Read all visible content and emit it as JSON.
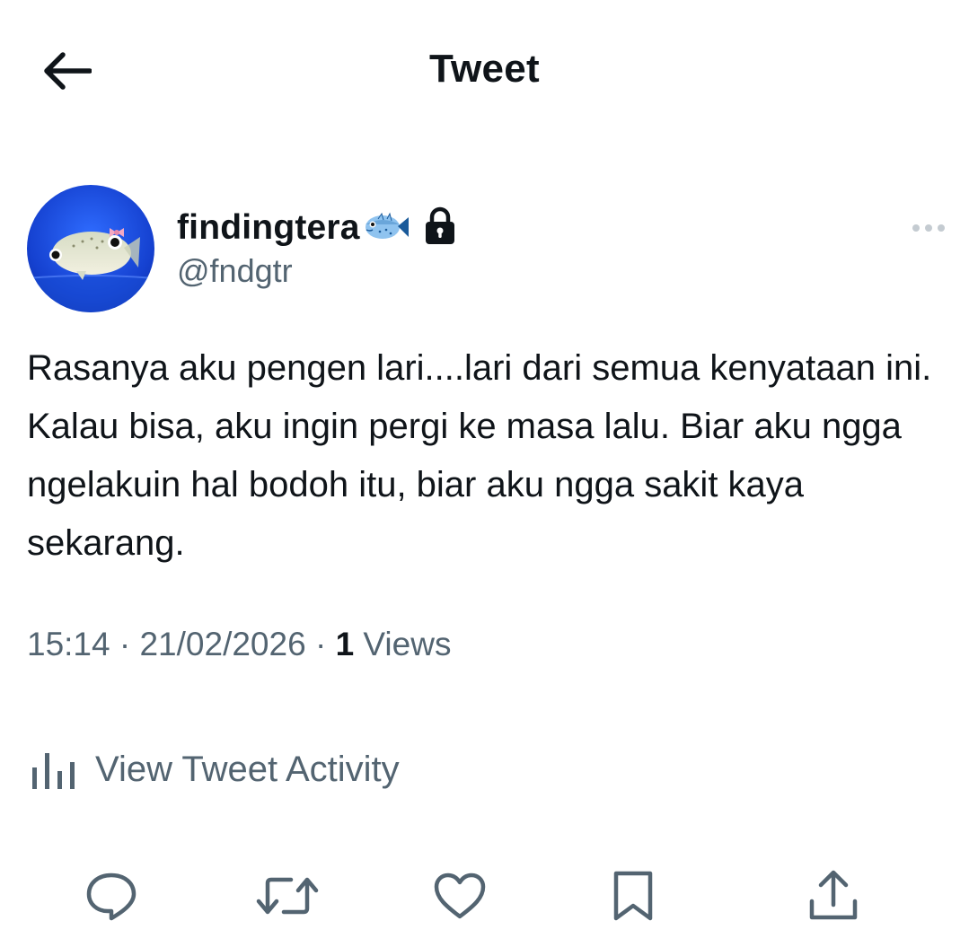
{
  "header": {
    "title": "Tweet",
    "back_icon": "arrow-left-icon"
  },
  "tweet": {
    "author": {
      "display_name": "findingtera",
      "handle": "@fndgtr",
      "name_emoji": "blowfish-icon",
      "protected_icon": "lock-icon"
    },
    "text": "Rasanya aku pengen lari....lari dari semua kenyataan ini. Kalau bisa, aku ingin pergi ke masa lalu. Biar aku ngga ngelakuin hal bodoh itu, biar aku ngga sakit kaya sekarang.",
    "time": "15:14",
    "date": "21/02/2026",
    "separator": "·",
    "views_count": "1",
    "views_label": "Views",
    "activity_label": "View Tweet Activity"
  },
  "actions": [
    {
      "name": "reply",
      "icon": "reply-icon"
    },
    {
      "name": "retweet",
      "icon": "retweet-icon"
    },
    {
      "name": "like",
      "icon": "heart-icon"
    },
    {
      "name": "bookmark",
      "icon": "bookmark-icon"
    },
    {
      "name": "share",
      "icon": "share-icon"
    }
  ],
  "colors": {
    "text_primary": "#0f1419",
    "text_secondary": "#536471",
    "avatar_bg": "#1a4fd6",
    "background": "#ffffff"
  }
}
